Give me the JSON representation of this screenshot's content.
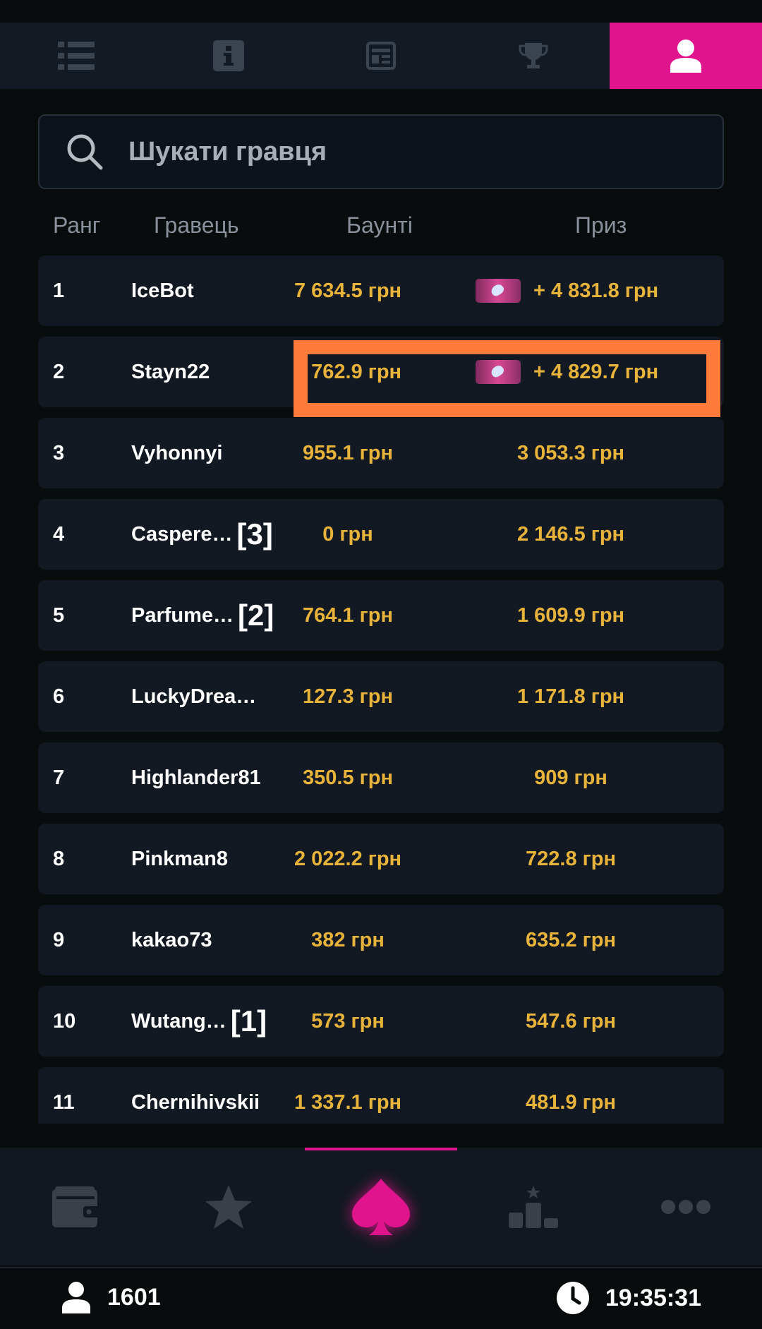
{
  "top_tabs": [
    {
      "icon": "list-icon"
    },
    {
      "icon": "info-icon"
    },
    {
      "icon": "news-icon"
    },
    {
      "icon": "trophy-icon"
    },
    {
      "icon": "user-icon",
      "active": true
    }
  ],
  "search": {
    "placeholder": "Шукати гравця"
  },
  "headers": {
    "rank": "Ранг",
    "player": "Гравець",
    "bounty": "Баунті",
    "prize": "Приз"
  },
  "rows": [
    {
      "rank": "1",
      "name": "IceBot",
      "badge": "",
      "bounty": "7 634.5 грн",
      "prize": "+ 4 831.8 грн",
      "ticket": true
    },
    {
      "rank": "2",
      "name": "Stayn22",
      "badge": "",
      "bounty": "2 762.9 грн",
      "prize": "+ 4 829.7 грн",
      "ticket": true
    },
    {
      "rank": "3",
      "name": "Vyhonnyi",
      "badge": "",
      "bounty": "955.1 грн",
      "prize": "3 053.3 грн",
      "ticket": false
    },
    {
      "rank": "4",
      "name": "Caspere…",
      "badge": "[3]",
      "bounty": "0 грн",
      "prize": "2 146.5 грн",
      "ticket": false
    },
    {
      "rank": "5",
      "name": "Parfume…",
      "badge": "[2]",
      "bounty": "764.1 грн",
      "prize": "1 609.9 грн",
      "ticket": false
    },
    {
      "rank": "6",
      "name": "LuckyDrea…",
      "badge": "",
      "bounty": "127.3 грн",
      "prize": "1 171.8 грн",
      "ticket": false
    },
    {
      "rank": "7",
      "name": "Highlander81",
      "badge": "",
      "bounty": "350.5 грн",
      "prize": "909 грн",
      "ticket": false
    },
    {
      "rank": "8",
      "name": "Pinkman8",
      "badge": "",
      "bounty": "2 022.2 грн",
      "prize": "722.8 грн",
      "ticket": false
    },
    {
      "rank": "9",
      "name": "kakao73",
      "badge": "",
      "bounty": "382 грн",
      "prize": "635.2 грн",
      "ticket": false
    },
    {
      "rank": "10",
      "name": "Wutang…",
      "badge": "[1]",
      "bounty": "573 грн",
      "prize": "547.6 грн",
      "ticket": false
    },
    {
      "rank": "11",
      "name": "Chernihivskii",
      "badge": "",
      "bounty": "1 337.1 грн",
      "prize": "481.9 грн",
      "ticket": false
    }
  ],
  "bottom_nav": [
    {
      "icon": "wallet-icon"
    },
    {
      "icon": "star-icon"
    },
    {
      "icon": "spade-icon",
      "active": true
    },
    {
      "icon": "leaderboard-icon"
    },
    {
      "icon": "more-icon"
    }
  ],
  "status": {
    "players": "1601",
    "time": "19:35:31"
  },
  "colors": {
    "accent": "#e0148c",
    "gold": "#e7b33a",
    "highlight": "#ff7b3c"
  }
}
